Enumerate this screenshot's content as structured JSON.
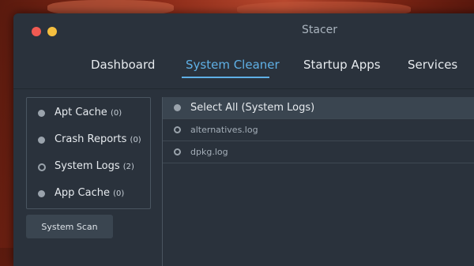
{
  "window": {
    "title": "Stacer"
  },
  "nav": {
    "tabs": [
      {
        "label": "Dashboard"
      },
      {
        "label": "System Cleaner",
        "active": true
      },
      {
        "label": "Startup Apps"
      },
      {
        "label": "Services"
      }
    ]
  },
  "categories": [
    {
      "label": "Apt Cache",
      "count": "(0)"
    },
    {
      "label": "Crash Reports",
      "count": "(0)"
    },
    {
      "label": "System Logs",
      "count": "(2)",
      "selected": true
    },
    {
      "label": "App Cache",
      "count": "(0)"
    }
  ],
  "scan_button": {
    "label": "System Scan"
  },
  "file_list": {
    "select_all": "Select All (System Logs)",
    "files": [
      {
        "name": "alternatives.log"
      },
      {
        "name": "dpkg.log"
      }
    ]
  },
  "colors": {
    "accent": "#5fb0e6",
    "window_bg": "#2a323c",
    "close": "#f05a52",
    "minimize": "#f5bf3f"
  }
}
